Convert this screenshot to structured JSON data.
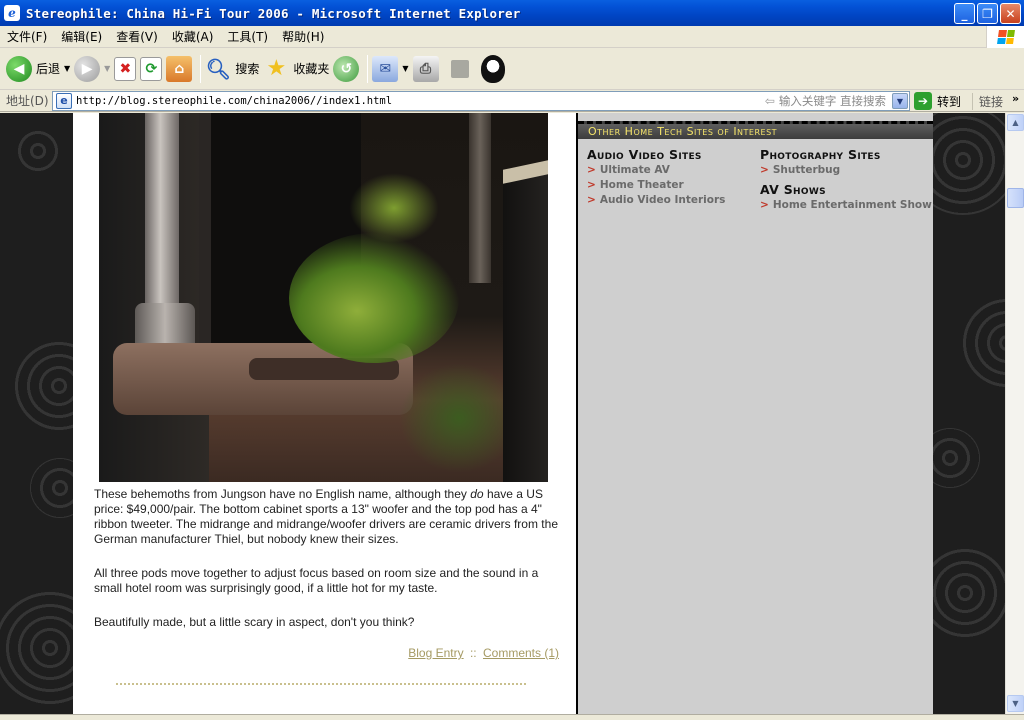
{
  "window": {
    "title": "Stereophile: China Hi-Fi Tour 2006 - Microsoft Internet Explorer",
    "app_icon": "ie-page-icon",
    "buttons": [
      "minimize-icon",
      "restore-icon",
      "close-icon"
    ]
  },
  "menu": [
    "文件(F)",
    "编辑(E)",
    "查看(V)",
    "收藏(A)",
    "工具(T)",
    "帮助(H)"
  ],
  "toolbar": {
    "back_label": "后退",
    "search_label": "搜索",
    "favorites_label": "收藏夹"
  },
  "address": {
    "label": "地址(D)",
    "url": "http://blog.stereophile.com/china2006//index1.html",
    "search_placeholder": "输入关键字 直接搜索",
    "go_label": "转到",
    "links_label": "链接"
  },
  "post": {
    "para1_pre": "These behemoths from Jungson have no English name, although they ",
    "para1_em": "do",
    "para1_post": " have a US price: $49,000/pair. The bottom cabinet sports a 13\" woofer and the top pod has a 4\" ribbon tweeter. The midrange and midrange/woofer drivers are ceramic drivers from the German manufacturer Thiel, but nobody knew their sizes.",
    "para2": "All three pods move together to adjust focus based on room size and the sound in a small hotel room was surprisingly good, if a little hot for my taste.",
    "para3": "Beautifully made, but a little scary in aspect, don't you think?",
    "entry_link": "Blog Entry",
    "separator": "::",
    "comments_link": "Comments (1)"
  },
  "sidebar": {
    "heading": "Other Home Tech Sites of Interest",
    "col1": {
      "title": "Audio Video Sites",
      "links": [
        "Ultimate AV",
        "Home Theater",
        "Audio Video Interiors"
      ]
    },
    "col2": {
      "title1": "Photography Sites",
      "links1": [
        "Shutterbug"
      ],
      "title2": "AV Shows",
      "links2": [
        "Home Entertainment Show"
      ]
    },
    "arrow": ">"
  },
  "colors": {
    "link_gold": "#A59A63",
    "sidebar_heading": "#F5E46A",
    "sidebar_arrow": "#C0392B"
  }
}
